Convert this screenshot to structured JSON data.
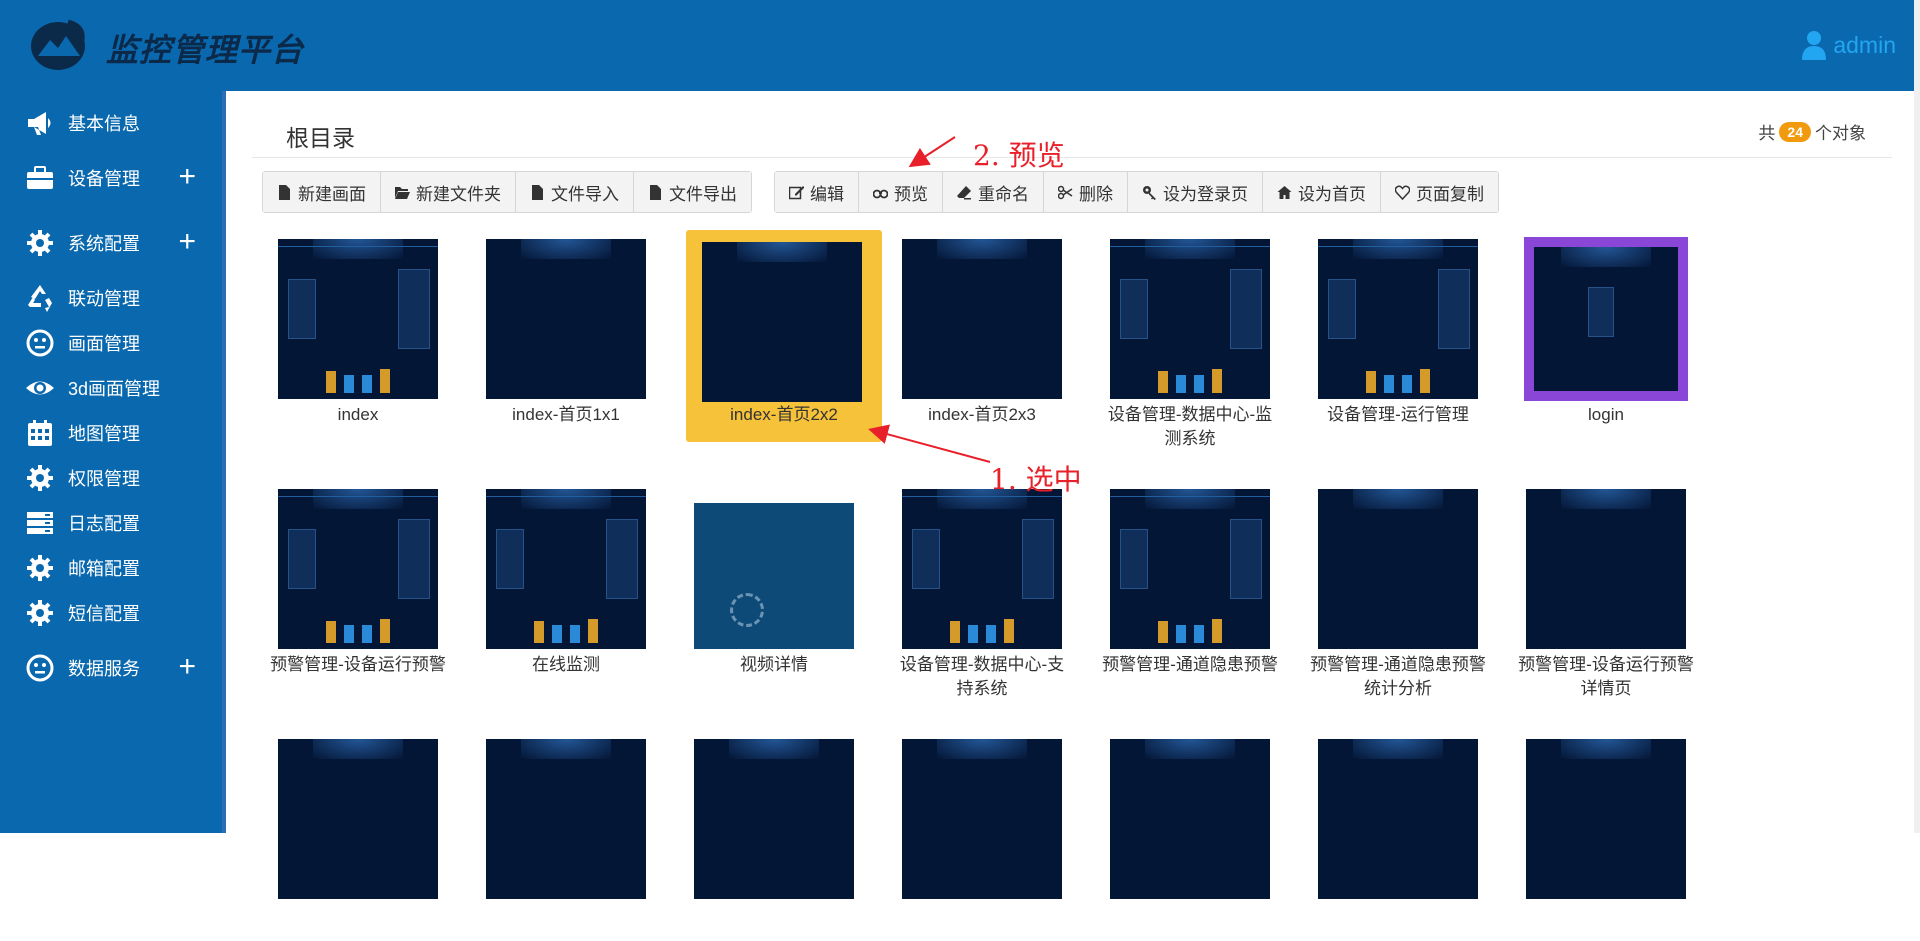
{
  "header": {
    "title": "监控管理平台",
    "user": "admin",
    "colors": {
      "bar": "#0a68ae",
      "user": "#22a6f2"
    }
  },
  "sidebar": {
    "items": [
      {
        "label": "基本信息",
        "icon": "megaphone-icon",
        "expandable": false
      },
      {
        "label": "设备管理",
        "icon": "briefcase-icon",
        "expandable": true
      },
      {
        "label": "系统配置",
        "icon": "gear-icon",
        "expandable": true
      },
      {
        "label": "联动管理",
        "icon": "recycle-icon",
        "expandable": false
      },
      {
        "label": "画面管理",
        "icon": "smiley-icon",
        "expandable": false
      },
      {
        "label": "3d画面管理",
        "icon": "eye-icon",
        "expandable": false
      },
      {
        "label": "地图管理",
        "icon": "calendar-icon",
        "expandable": false
      },
      {
        "label": "权限管理",
        "icon": "gear-icon",
        "expandable": false
      },
      {
        "label": "日志配置",
        "icon": "server-icon",
        "expandable": false
      },
      {
        "label": "邮箱配置",
        "icon": "gear-icon",
        "expandable": false
      },
      {
        "label": "短信配置",
        "icon": "gear-icon",
        "expandable": false
      },
      {
        "label": "数据服务",
        "icon": "smiley-icon",
        "expandable": true
      }
    ],
    "plus_symbol": "+"
  },
  "content": {
    "folder_title": "根目录",
    "count_prefix": "共",
    "count": "24",
    "count_suffix": "个对象",
    "toolbar_left": [
      {
        "label": "新建画面",
        "icon": "file-icon"
      },
      {
        "label": "新建文件夹",
        "icon": "folder-open-icon"
      },
      {
        "label": "文件导入",
        "icon": "file-icon"
      },
      {
        "label": "文件导出",
        "icon": "file-icon"
      }
    ],
    "toolbar_right": [
      {
        "label": "编辑",
        "icon": "edit-icon"
      },
      {
        "label": "预览",
        "icon": "binoculars-icon"
      },
      {
        "label": "重命名",
        "icon": "eraser-icon"
      },
      {
        "label": "删除",
        "icon": "scissors-icon"
      },
      {
        "label": "设为登录页",
        "icon": "key-icon"
      },
      {
        "label": "设为首页",
        "icon": "home-icon"
      },
      {
        "label": "页面复制",
        "icon": "heart-icon"
      }
    ],
    "tiles": [
      {
        "caption": "index",
        "style": "dash"
      },
      {
        "caption": "index-首页1x1",
        "style": "blank"
      },
      {
        "caption": "index-首页2x2",
        "style": "blank",
        "selected": true
      },
      {
        "caption": "index-首页2x3",
        "style": "blank"
      },
      {
        "caption": "设备管理-数据中心-监测系统",
        "style": "dash"
      },
      {
        "caption": "设备管理-运行管理",
        "style": "dash"
      },
      {
        "caption": "login",
        "style": "login"
      },
      {
        "caption": "预警管理-设备运行预警",
        "style": "dash"
      },
      {
        "caption": "在线监测",
        "style": "dash"
      },
      {
        "caption": "视频详情",
        "style": "video"
      },
      {
        "caption": "设备管理-数据中心-支持系统",
        "style": "dash"
      },
      {
        "caption": "预警管理-通道隐患预警",
        "style": "dash"
      },
      {
        "caption": "预警管理-通道隐患预警统计分析",
        "style": "blank"
      },
      {
        "caption": "预警管理-设备运行预警详情页",
        "style": "blank"
      },
      {
        "caption": "",
        "style": "blank"
      },
      {
        "caption": "",
        "style": "blank"
      },
      {
        "caption": "",
        "style": "blank"
      },
      {
        "caption": "",
        "style": "blank"
      },
      {
        "caption": "",
        "style": "blank"
      },
      {
        "caption": "",
        "style": "blank"
      },
      {
        "caption": "",
        "style": "blank"
      }
    ],
    "selection_color": "#f5c23a"
  },
  "annotations": {
    "step1": "1. 选中",
    "step2": "2. 预览",
    "color": "#e8202a"
  }
}
